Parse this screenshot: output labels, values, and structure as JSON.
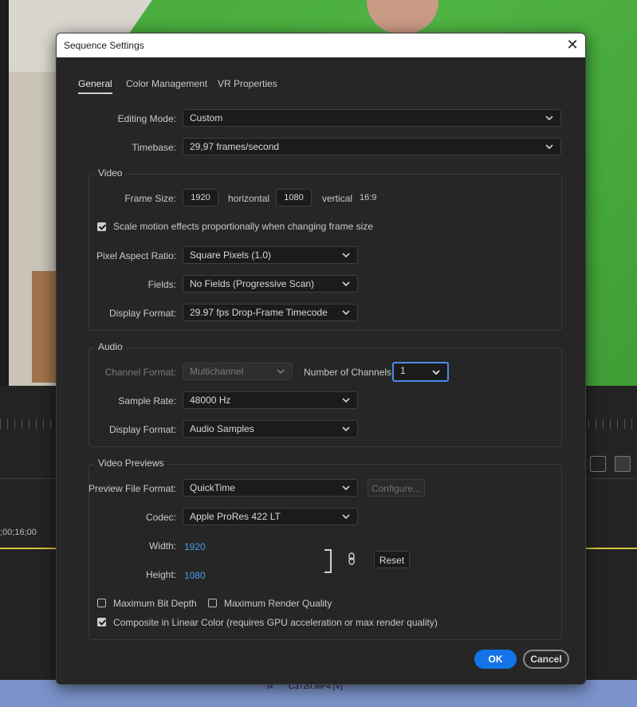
{
  "dialog": {
    "title": "Sequence Settings",
    "tabs": [
      {
        "label": "General",
        "active": true
      },
      {
        "label": "Color Management",
        "active": false
      },
      {
        "label": "VR Properties",
        "active": false
      }
    ],
    "general": {
      "editing_mode": {
        "label": "Editing Mode:",
        "value": "Custom"
      },
      "timebase": {
        "label": "Timebase:",
        "value": "29,97  frames/second"
      }
    },
    "video": {
      "title": "Video",
      "frame_size_label": "Frame Size:",
      "width": "1920",
      "horizontal_label": "horizontal",
      "height": "1080",
      "vertical_label": "vertical",
      "aspect": "16:9",
      "scale_motion": {
        "label": "Scale motion effects proportionally when changing frame size",
        "checked": true
      },
      "pixel_aspect": {
        "label": "Pixel Aspect Ratio:",
        "value": "Square Pixels (1.0)"
      },
      "fields": {
        "label": "Fields:",
        "value": "No Fields (Progressive Scan)"
      },
      "display_format": {
        "label": "Display Format:",
        "value": "29.97 fps Drop-Frame Timecode"
      }
    },
    "audio": {
      "title": "Audio",
      "channel_format": {
        "label": "Channel Format:",
        "value": "Multichannel",
        "disabled": true
      },
      "num_channels": {
        "label": "Number of Channels:",
        "value": "1"
      },
      "sample_rate": {
        "label": "Sample Rate:",
        "value": "48000 Hz"
      },
      "display_format": {
        "label": "Display Format:",
        "value": "Audio Samples"
      }
    },
    "previews": {
      "title": "Video Previews",
      "file_format": {
        "label": "Preview File Format:",
        "value": "QuickTime"
      },
      "configure_label": "Configure...",
      "codec": {
        "label": "Codec:",
        "value": "Apple ProRes 422 LT"
      },
      "width": {
        "label": "Width:",
        "value": "1920"
      },
      "height": {
        "label": "Height:",
        "value": "1080"
      },
      "reset_label": "Reset",
      "max_bit_depth": {
        "label": "Maximum Bit Depth",
        "checked": false
      },
      "max_render_quality": {
        "label": "Maximum Render Quality",
        "checked": false
      },
      "linear_color": {
        "label": "Composite in Linear Color (requires GPU acceleration or max render quality)",
        "checked": true
      }
    },
    "ok_label": "OK",
    "cancel_label": "Cancel"
  },
  "timeline": {
    "timecode": ";00;16;00",
    "clip_label": "C3720.MP4 [V]",
    "fx_label": "fx"
  },
  "colors": {
    "accent": "#1473e6",
    "focus": "#4a8ee6",
    "link_value": "#4a9cf0",
    "clip": "#7b93c9"
  }
}
